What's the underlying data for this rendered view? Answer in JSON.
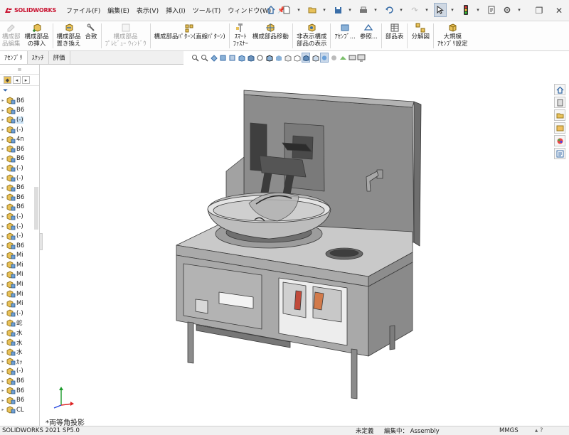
{
  "app": {
    "name": "SOLIDWORKS",
    "logo_icon": "solidworks-ds-logo"
  },
  "menu": [
    "ファイル(F)",
    "編集(E)",
    "表示(V)",
    "挿入(I)",
    "ツール(T)",
    "ウィンドウ(W)"
  ],
  "quick_access_icons": [
    "home-icon",
    "new-document-icon",
    "open-icon",
    "save-icon",
    "print-icon",
    "undo-icon",
    "redo-icon",
    "select-icon",
    "traffic-light-icon",
    "file-properties-icon",
    "options-icon"
  ],
  "ribbon": [
    {
      "label": "構成部\n品編集",
      "icon": "edit-component-icon",
      "disabled": true
    },
    {
      "label": "構成部品\nの挿入",
      "icon": "insert-component-icon",
      "disabled": false
    },
    {
      "label": "構成部品\n置き換え",
      "icon": "replace-component-icon",
      "disabled": false
    },
    {
      "label": "合致",
      "icon": "mate-icon",
      "disabled": false
    },
    {
      "label": "構成部品\nﾌﾟﾚﾋﾞｭｰ ｳｨﾝﾄﾞｳ",
      "icon": "preview-window-icon",
      "disabled": true
    },
    {
      "label": "構成部品ﾊﾟﾀｰﾝ(直線ﾊﾟﾀｰﾝ)",
      "icon": "linear-pattern-icon",
      "disabled": false
    },
    {
      "label": "ｽﾏｰﾄ\nﾌｧｽﾅｰ",
      "icon": "smart-fastener-icon",
      "disabled": false
    },
    {
      "label": "構成部品移動",
      "icon": "move-component-icon",
      "disabled": false
    },
    {
      "label": "非表示構成\n部品の表示",
      "icon": "show-hidden-icon",
      "disabled": false
    },
    {
      "label": "ｱｾﾝﾌﾞ...",
      "icon": "assembly-features-icon",
      "disabled": false
    },
    {
      "label": "参照...",
      "icon": "reference-geometry-icon",
      "disabled": false
    },
    {
      "label": "部品表",
      "icon": "bom-icon",
      "disabled": false
    },
    {
      "label": "分解図",
      "icon": "exploded-view-icon",
      "disabled": false
    },
    {
      "label": "大規模\nｱｾﾝﾌﾞﾘ設定",
      "icon": "large-assembly-icon",
      "disabled": false
    }
  ],
  "tabs": [
    "ｱｾﾝﾌﾞﾘ",
    "ｽｹｯﾁ",
    "評価"
  ],
  "active_tab": 0,
  "tree_items": [
    "B6",
    "B6",
    "(-)",
    "(-)",
    "4n",
    "B6",
    "B6",
    "(-)",
    "(-)",
    "B6",
    "B6",
    "B6",
    "(-)",
    "(-)",
    "(-)",
    "B6",
    "Mi",
    "Mi",
    "Mi",
    "Mi",
    "Mi",
    "Mi",
    "(-)",
    "蛇",
    "水",
    "水",
    "水",
    "ｶｯ",
    "(-)",
    "B6",
    "B6",
    "B6",
    "CL"
  ],
  "tree_selected_index": 2,
  "view_name": "*両等角投影",
  "status": {
    "app": "SOLIDWORKS 2021 SP5.0",
    "definition": "未定義",
    "editing": "編集中： Assembly",
    "units": "MMGS"
  },
  "colors": {
    "accent": "#2b6cb0",
    "ribbon_bg": "#fdfdfd",
    "selection": "#cce4f7"
  },
  "task_pane_icons": [
    "home-pane-icon",
    "resources-icon",
    "design-library-icon",
    "file-explorer-icon",
    "appearances-icon",
    "custom-properties-icon"
  ]
}
